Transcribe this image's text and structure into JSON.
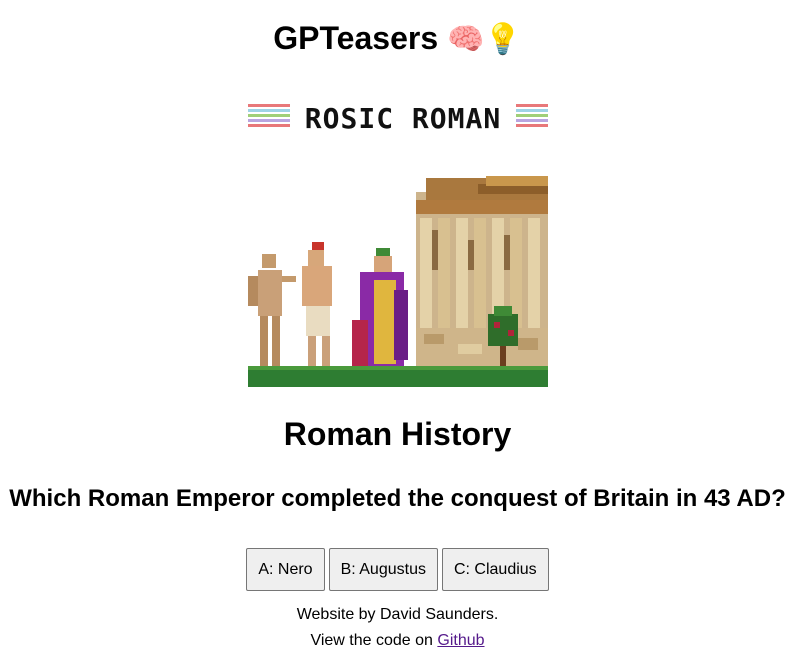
{
  "header": {
    "title": "GPTeasers",
    "emojis": "🧠💡"
  },
  "hero_image": {
    "banner_text": "ROSIC ROMAN",
    "depicts": "pixel-art-roman-figures-and-temple"
  },
  "quiz": {
    "topic": "Roman History",
    "question": "Which Roman Emperor completed the conquest of Britain in 43 AD?",
    "answers": [
      {
        "label": "A: Nero"
      },
      {
        "label": "B: Augustus"
      },
      {
        "label": "C: Claudius"
      }
    ]
  },
  "footer": {
    "credit": "Website by David Saunders.",
    "code_prefix": "View the code on ",
    "code_link": "Github"
  },
  "colors": {
    "link": "#551a8b",
    "button_bg": "#efefef",
    "grass": "#2e7d32"
  }
}
